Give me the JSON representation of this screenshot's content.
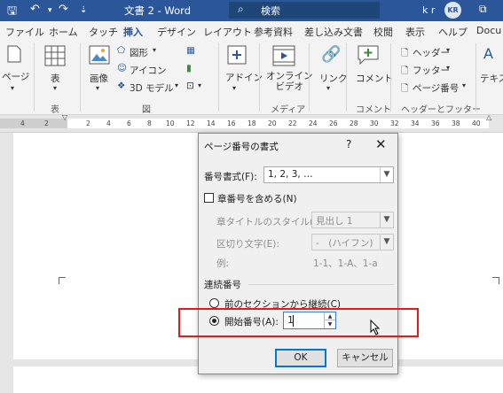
{
  "titlebar": {
    "doc_title": "文書 2  -  Word",
    "search_label": "検索",
    "user_initials_text": "k r",
    "avatar": "KR"
  },
  "tabs": [
    "ファイル",
    "ホーム",
    "タッチ",
    "挿入",
    "デザイン",
    "レイアウト",
    "参考資料",
    "差し込み文書",
    "校閲",
    "表示",
    "ヘルプ",
    "Docu"
  ],
  "active_tab": "挿入",
  "ribbon": {
    "page_label": "ページ",
    "table_label": "表",
    "image_label": "画像",
    "shapes_label": "図形",
    "icons_label": "アイコン",
    "model3d_label": "3D モデル",
    "addin_label": "アドイン",
    "online_video_label": "オンライン\nビデオ",
    "link_label": "リンク",
    "comment_label": "コメント",
    "header_label": "ヘッダー",
    "footer_label": "フッター",
    "page_number_label": "ページ番号",
    "text_label": "テキス",
    "groups": {
      "table": "表",
      "figure": "図",
      "media": "メディア",
      "comment": "コメント",
      "header_footer": "ヘッダーとフッター"
    }
  },
  "ruler_numbers": [
    "4",
    "2",
    "2",
    "4",
    "6",
    "8",
    "10",
    "12",
    "14",
    "16",
    "18",
    "20",
    "22",
    "24",
    "26",
    "28",
    "30",
    "32",
    "34",
    "36",
    "38",
    "40"
  ],
  "dialog": {
    "title": "ページ番号の書式",
    "help": "?",
    "close": "✕",
    "format_label": "番号書式(F):",
    "format_value": "1, 2, 3, …",
    "include_chapter_label": "章番号を含める(N)",
    "chapter_style_label": "章タイトルのスタイル(P):",
    "chapter_style_value": "見出し 1",
    "separator_label": "区切り文字(E):",
    "separator_value": "-　(ハイフン)",
    "example_label": "例:",
    "example_value": "1-1、1-A、1-a",
    "numbering_section": "連続番号",
    "continue_label": "前のセクションから継続(C)",
    "start_at_label": "開始番号(A):",
    "start_at_value": "1",
    "ok": "OK",
    "cancel": "キャンセル"
  },
  "colors": {
    "accent": "#2b579a",
    "highlight": "#e21c1c",
    "focus": "#0078d7"
  }
}
